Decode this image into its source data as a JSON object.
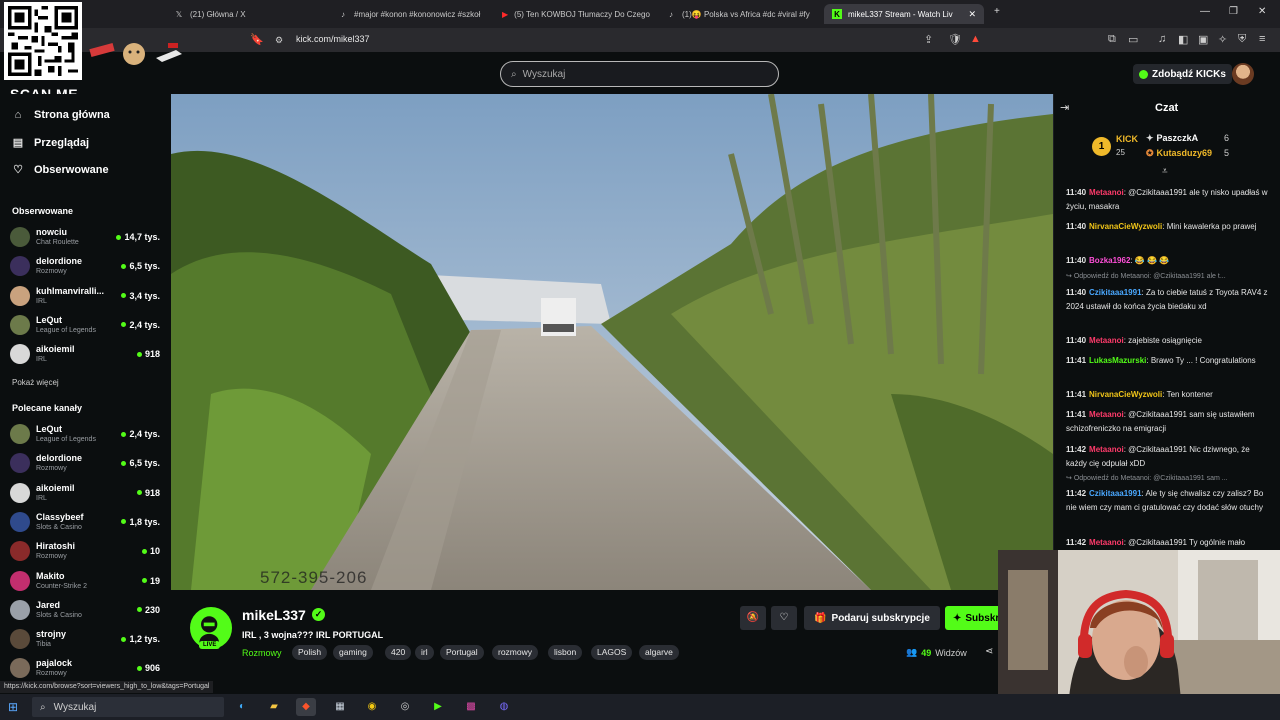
{
  "browser": {
    "tabs": [
      {
        "label": "(21) Główna / X",
        "icon": "x-icon"
      },
      {
        "label": "#major #konon #kononowicz #szkoł",
        "icon": "tiktok-icon"
      },
      {
        "label": "(5) Ten KOWBOJ Tłumaczy Do Czego",
        "icon": "youtube-icon"
      },
      {
        "label": "(1)😝 Polska vs Africa #dc #viral #fy",
        "icon": "tiktok-icon"
      },
      {
        "label": "mikeL337 Stream - Watch Liv",
        "icon": "kick-icon"
      }
    ],
    "url": "kick.com/mikel337"
  },
  "overlay": {
    "scan_me": "SCAN ME",
    "phone_watermark": "572-395-206"
  },
  "header": {
    "search_placeholder": "Wyszukaj",
    "get_kicks": "Zdobądź KICKs"
  },
  "sidebar": {
    "nav": [
      {
        "label": "Strona główna",
        "icon": "home-icon"
      },
      {
        "label": "Przeglądaj",
        "icon": "browse-icon"
      },
      {
        "label": "Obserwowane",
        "icon": "heart-icon"
      }
    ],
    "followed_title": "Obserwowane",
    "followed": [
      {
        "name": "nowciu",
        "category": "Chat Roulette",
        "viewers": "14,7 tys.",
        "color": "#4a5a3a"
      },
      {
        "name": "delordione",
        "category": "Rozmowy",
        "viewers": "6,5 tys.",
        "color": "#3b2f5c"
      },
      {
        "name": "kuhlmanviralli...",
        "category": "IRL",
        "viewers": "3,4 tys.",
        "color": "#c9a27e"
      },
      {
        "name": "LeQut",
        "category": "League of Legends",
        "viewers": "2,4 tys.",
        "color": "#6c7a4a"
      },
      {
        "name": "aikoiemil",
        "category": "IRL",
        "viewers": "918",
        "color": "#d8d8d8"
      }
    ],
    "show_more": "Pokaż więcej",
    "recommended_title": "Polecane kanały",
    "recommended": [
      {
        "name": "LeQut",
        "category": "League of Legends",
        "viewers": "2,4 tys.",
        "color": "#6c7a4a"
      },
      {
        "name": "delordione",
        "category": "Rozmowy",
        "viewers": "6,5 tys.",
        "color": "#3b2f5c"
      },
      {
        "name": "aikoiemil",
        "category": "IRL",
        "viewers": "918",
        "color": "#d8d8d8"
      },
      {
        "name": "Classybeef",
        "category": "Slots & Casino",
        "viewers": "1,8 tys.",
        "color": "#2f4a8c"
      },
      {
        "name": "Hiratoshi",
        "category": "Rozmowy",
        "viewers": "10",
        "color": "#8a2a2a"
      },
      {
        "name": "Makito",
        "category": "Counter-Strike 2",
        "viewers": "19",
        "color": "#c22e6e"
      },
      {
        "name": "Jared",
        "category": "Slots & Casino",
        "viewers": "230",
        "color": "#9aa0a8"
      },
      {
        "name": "strojny",
        "category": "Tibia",
        "viewers": "1,2 tys.",
        "color": "#5a4a3a"
      },
      {
        "name": "pajalock",
        "category": "Rozmowy",
        "viewers": "906",
        "color": "#7a6a5a"
      }
    ]
  },
  "stream": {
    "name": "mikeL337",
    "live_badge": "LIVE",
    "title": "IRL , 3 wojna??? IRL PORTUGAL",
    "category": "Rozmowy",
    "tags": [
      "Polish",
      "gaming",
      "420",
      "irl",
      "Portugal",
      "rozmowy",
      "lisbon",
      "LAGOS",
      "algarve"
    ],
    "gift_label": "Podaruj subskrypcje",
    "subscribe_label": "Subskrybuj",
    "viewers_count": "49",
    "viewers_label": "Widzów"
  },
  "chat": {
    "title": "Czat",
    "leaderboard": {
      "rank": "1",
      "kick_label": "KICK",
      "kick_count": "25",
      "users": [
        {
          "name": "PaszczkA",
          "count": "6"
        },
        {
          "name": "Kutasduzy69",
          "count": "5"
        }
      ]
    },
    "messages": [
      {
        "time": "11:40",
        "user": "Metaanoi",
        "color": "#ff3b6b",
        "text": "@Czikitaaa1991 ale ty nisko upadłaś w życiu, masakra"
      },
      {
        "time": "11:40",
        "user": "NirvanaCieWyzwoli",
        "color": "#f0c419",
        "text": "Mini kawalerka po prawej"
      },
      {
        "time": "11:40",
        "user": "Bozka1962",
        "color": "#ff4fd8",
        "text": "😂 😂 😂"
      },
      {
        "reply": "Odpowiedź do Metaanoi: @Czikitaaa1991 ale t..."
      },
      {
        "time": "11:40",
        "user": "Czikitaaa1991",
        "color": "#4aa8ff",
        "text": "Za to ciebie tatuś z Toyota RAV4 z 2024 ustawił do końca życia biedaku xd"
      },
      {
        "time": "11:40",
        "user": "Metaanoi",
        "color": "#ff3b6b",
        "text": "zajebiste osiągnięcie"
      },
      {
        "time": "11:41",
        "user": "LukasMazurski",
        "color": "#53fc18",
        "text": "Brawo Ty ... ! Congratulations"
      },
      {
        "time": "11:41",
        "user": "NirvanaCieWyzwoli",
        "color": "#f0c419",
        "text": "Ten kontener"
      },
      {
        "time": "11:41",
        "user": "Metaanoi",
        "color": "#ff3b6b",
        "text": "@Czikitaaa1991 sam się ustawiłem schizofreniczko na emigracji"
      },
      {
        "time": "11:42",
        "user": "Metaanoi",
        "color": "#ff3b6b",
        "text": "@Czikitaaa1991 Nic dziwnego, że każdy cię odpulał xDD"
      },
      {
        "reply": "Odpowiedź do Metaanoi: @Czikitaaa1991 sam ..."
      },
      {
        "time": "11:42",
        "user": "Czikitaaa1991",
        "color": "#4aa8ff",
        "text": "Ale ty się chwalisz czy zalisz? Bo nie wiem czy mam ci gratulować czy dodać słów otuchy"
      },
      {
        "time": "11:42",
        "user": "Metaanoi",
        "color": "#ff3b6b",
        "text": "@Czikitaaa1991 Ty ogólnie mało"
      }
    ]
  },
  "status_url": "https://kick.com/browse?sort=viewers_high_to_low&tags=Portugal",
  "taskbar": {
    "search_label": "Wyszukaj"
  }
}
